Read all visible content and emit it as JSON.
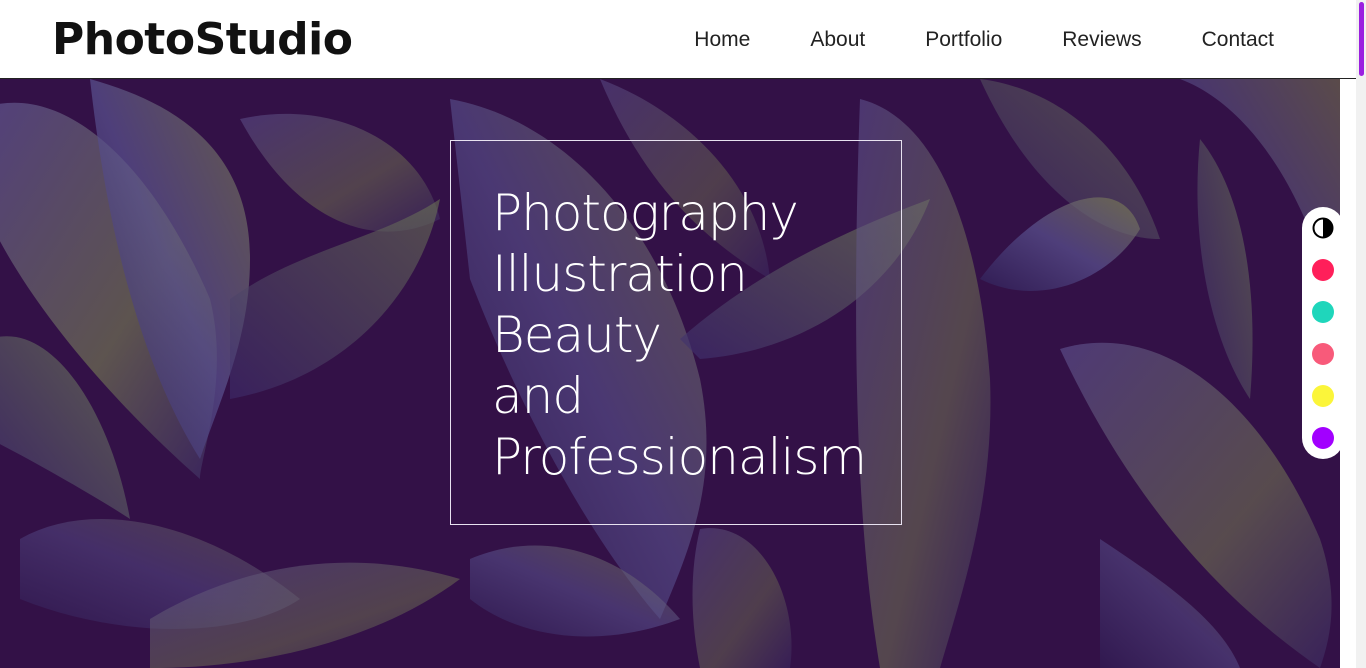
{
  "header": {
    "logo": "PhotoStudio",
    "nav": [
      "Home",
      "About",
      "Portfolio",
      "Reviews",
      "Contact"
    ]
  },
  "hero": {
    "lines": [
      "Photography",
      "Illustration",
      "Beauty",
      "and",
      "Professionalism"
    ],
    "background_color": "#331147"
  },
  "theme_switcher": {
    "toggle_icon": "contrast-icon",
    "colors": [
      "#ff1f5a",
      "#1fd6bb",
      "#f85a7a",
      "#fbf53a",
      "#a200ff"
    ]
  },
  "scrollbar": {
    "thumb_color": "#9b1fe0"
  }
}
